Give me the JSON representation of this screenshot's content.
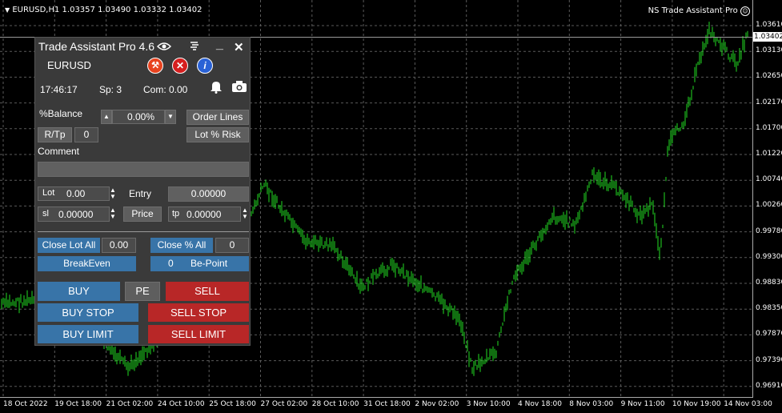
{
  "chart": {
    "header": "EURUSD,H1  1.03357 1.03490 1.03332 1.03402",
    "ea_name": "NS Trade Assistant Pro",
    "current_price": "1.03402",
    "price_labels": [
      "1.03610",
      "1.03130",
      "1.02650",
      "1.02170",
      "1.01700",
      "1.01220",
      "1.00740",
      "1.00260",
      "0.99780",
      "0.99300",
      "0.98830",
      "0.98350",
      "0.97870",
      "0.97390",
      "0.96910"
    ],
    "time_labels": [
      "18 Oct 2022",
      "19 Oct 18:00",
      "21 Oct 02:00",
      "24 Oct 10:00",
      "25 Oct 18:00",
      "27 Oct 02:00",
      "28 Oct 10:00",
      "31 Oct 18:00",
      "2 Nov 02:00",
      "3 Nov 10:00",
      "4 Nov 18:00",
      "8 Nov 03:00",
      "9 Nov 11:00",
      "10 Nov 19:00",
      "14 Nov 03:00"
    ],
    "colors": {
      "candle": "#22dd22",
      "grid": "#5a5a5a",
      "bg": "#000000"
    }
  },
  "panel": {
    "title": "Trade Assistant Pro 4.6",
    "symbol": "EURUSD",
    "time": "17:46:17",
    "spread": "Sp: 3",
    "commission": "Com: 0.00",
    "balance_label": "%Balance",
    "balance_value": "0.00%",
    "order_lines": "Order Lines",
    "rtp_label": "R/Tp",
    "rtp_value": "0",
    "lot_risk": "Lot % Risk",
    "comment_label": "Comment",
    "comment_value": "",
    "lot_label": "Lot",
    "lot_value": "0.00",
    "entry_label": "Entry",
    "entry_value": "0.00000",
    "sl_label": "sl",
    "sl_value": "0.00000",
    "price_button": "Price",
    "tp_label": "tp",
    "tp_value": "0.00000",
    "close_lot_all": "Close Lot All",
    "close_lot_value": "0.00",
    "close_pct_all": "Close % All",
    "close_pct_value": "0",
    "breakeven": "BreakEven",
    "be_point_value": "0",
    "be_point": "Be-Point",
    "buy": "BUY",
    "pe": "PE",
    "sell": "SELL",
    "buy_stop": "BUY STOP",
    "sell_stop": "SELL STOP",
    "buy_limit": "BUY LIMIT",
    "sell_limit": "SELL LIMIT",
    "icon_minimize": "_",
    "icon_close": "✕",
    "icon_info": "i",
    "colors": {
      "blue": "#3874a8",
      "red": "#b82727",
      "panel": "#3a3a3a"
    }
  }
}
